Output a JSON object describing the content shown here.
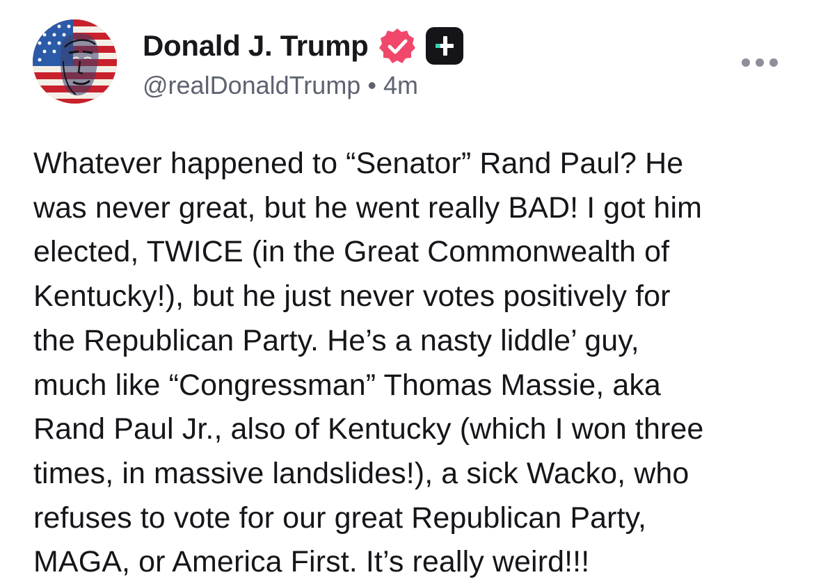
{
  "author": {
    "display_name": "Donald J. Trump",
    "handle": "@realDonaldTrump",
    "separator": "•",
    "timestamp": "4m",
    "verified_icon": "verified-badge-icon",
    "verified_color": "#f0476a",
    "plus_badge_icon": "plus-badge-icon",
    "avatar_icon": "american-flag-portrait-avatar"
  },
  "menu": {
    "icon": "more-options-icon"
  },
  "post": {
    "lines": [
      "Whatever happened to “Senator” Rand Paul? He",
      "was never great, but he went really BAD! I got him",
      "elected, TWICE (in the Great Commonwealth of",
      "Kentucky!), but he just never votes positively for",
      "the Republican Party. He’s a nasty liddle’ guy,",
      "much like “Congressman” Thomas Massie, aka",
      "Rand Paul Jr., also of Kentucky (which I won three",
      "times, in massive landslides!), a sick Wacko, who",
      "refuses to vote for our great Republican Party,",
      "MAGA, or America First. It’s really weird!!!"
    ]
  }
}
